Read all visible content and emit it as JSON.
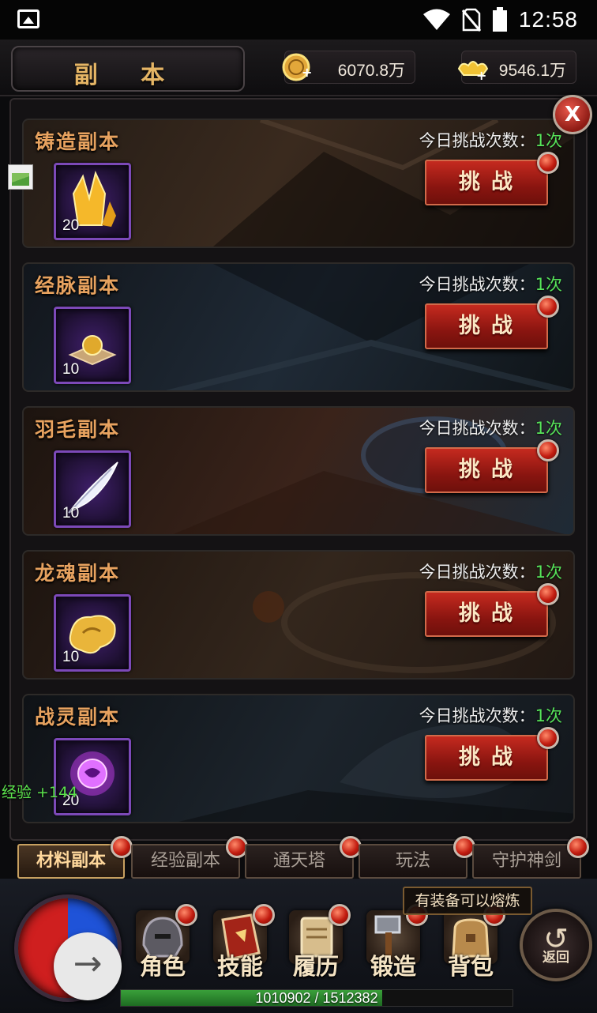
{
  "status_bar": {
    "time": "12:58",
    "icons": [
      "image-icon",
      "wifi-icon",
      "no-sim-icon",
      "battery-icon"
    ]
  },
  "header": {
    "title": "副 本",
    "gold": "6070.8万",
    "ingot": "9546.1万"
  },
  "close_label": "X",
  "dungeons": [
    {
      "name": "铸造副本",
      "count_label": "今日挑战次数：",
      "count": "1次",
      "item_qty": "20",
      "item_icon": "crystal-icon",
      "button": "挑战"
    },
    {
      "name": "经脉副本",
      "count_label": "今日挑战次数：",
      "count": "1次",
      "item_qty": "10",
      "item_icon": "orb-on-plate-icon",
      "button": "挑战"
    },
    {
      "name": "羽毛副本",
      "count_label": "今日挑战次数：",
      "count": "1次",
      "item_qty": "10",
      "item_icon": "feather-icon",
      "button": "挑战"
    },
    {
      "name": "龙魂副本",
      "count_label": "今日挑战次数：",
      "count": "1次",
      "item_qty": "10",
      "item_icon": "dragon-soul-icon",
      "button": "挑战"
    },
    {
      "name": "战灵副本",
      "count_label": "今日挑战次数：",
      "count": "1次",
      "item_qty": "20",
      "item_icon": "spirit-orb-icon",
      "button": "挑战"
    }
  ],
  "exp_float": "经验 +144",
  "tabs": [
    {
      "label": "材料副本",
      "active": true
    },
    {
      "label": "经验副本",
      "active": false
    },
    {
      "label": "通天塔",
      "active": false
    },
    {
      "label": "玩法",
      "active": false
    },
    {
      "label": "守护神剑",
      "active": false
    }
  ],
  "tooltip": "有装备可以熔炼",
  "nav": [
    {
      "label": "角色",
      "icon": "helmet-icon"
    },
    {
      "label": "技能",
      "icon": "skill-book-icon"
    },
    {
      "label": "履历",
      "icon": "scroll-icon"
    },
    {
      "label": "锻造",
      "icon": "hammer-icon"
    },
    {
      "label": "背包",
      "icon": "bag-icon"
    }
  ],
  "back_label": "返回",
  "exp": {
    "text": "1010902 / 1512382",
    "fraction": 0.668
  },
  "colors": {
    "accent_gold": "#e5b565",
    "count_green": "#57e45a",
    "button_red": "#c52a1f",
    "item_purple": "#7c49b8"
  }
}
